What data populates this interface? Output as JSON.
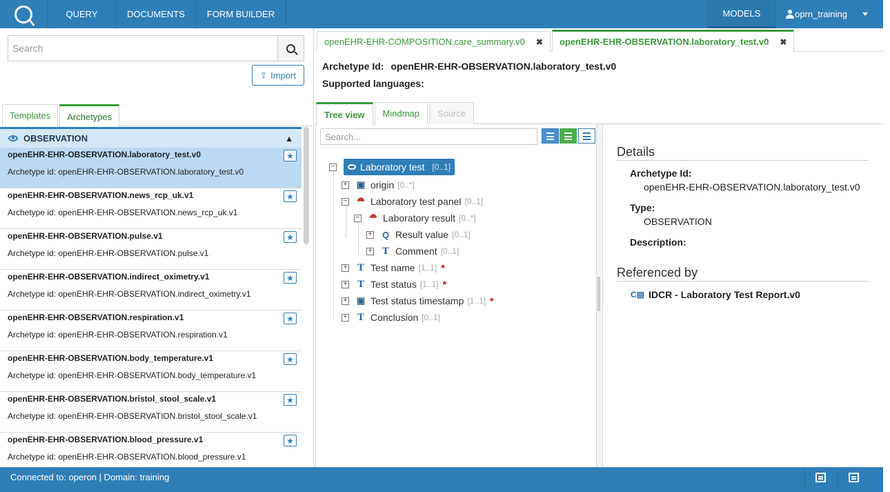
{
  "nav": {
    "logo": "Q",
    "items": [
      "QUERY",
      "DOCUMENTS",
      "FORM BUILDER"
    ],
    "models": "MODELS",
    "user": "oprn_training"
  },
  "left": {
    "search_placeholder": "Search",
    "import_label": "Import",
    "tabs": [
      "Templates",
      "Archetypes"
    ],
    "group": "OBSERVATION",
    "items": [
      {
        "name": "openEHR-EHR-OBSERVATION.laboratory_test.v0",
        "id": "Archetype id: openEHR-EHR-OBSERVATION.laboratory_test.v0"
      },
      {
        "name": "openEHR-EHR-OBSERVATION.news_rcp_uk.v1",
        "id": "Archetype id: openEHR-EHR-OBSERVATION.news_rcp_uk.v1"
      },
      {
        "name": "openEHR-EHR-OBSERVATION.pulse.v1",
        "id": "Archetype id: openEHR-EHR-OBSERVATION.pulse.v1"
      },
      {
        "name": "openEHR-EHR-OBSERVATION.indirect_oximetry.v1",
        "id": "Archetype id: openEHR-EHR-OBSERVATION.indirect_oximetry.v1"
      },
      {
        "name": "openEHR-EHR-OBSERVATION.respiration.v1",
        "id": "Archetype id: openEHR-EHR-OBSERVATION.respiration.v1"
      },
      {
        "name": "openEHR-EHR-OBSERVATION.body_temperature.v1",
        "id": "Archetype id: openEHR-EHR-OBSERVATION.body_temperature.v1"
      },
      {
        "name": "openEHR-EHR-OBSERVATION.bristol_stool_scale.v1",
        "id": "Archetype id: openEHR-EHR-OBSERVATION.bristol_stool_scale.v1"
      },
      {
        "name": "openEHR-EHR-OBSERVATION.blood_pressure.v1",
        "id": "Archetype id: openEHR-EHR-OBSERVATION.blood_pressure.v1"
      }
    ]
  },
  "right": {
    "file_tabs": [
      "openEHR-EHR-COMPOSITION.care_summary.v0",
      "openEHR-EHR-OBSERVATION.laboratory_test.v0"
    ],
    "archetype_id_label": "Archetype Id:",
    "archetype_id_value": "openEHR-EHR-OBSERVATION.laboratory_test.v0",
    "languages_label": "Supported languages:",
    "view_tabs": [
      "Tree view",
      "Mindmap",
      "Source"
    ],
    "tree_search_placeholder": "Search...",
    "tree": [
      {
        "label": "Laboratory test",
        "occ": "[0..1]"
      },
      {
        "label": "origin",
        "occ": "[0..*]"
      },
      {
        "label": "Laboratory test panel",
        "occ": "[0..1]"
      },
      {
        "label": "Laboratory result",
        "occ": "[0..*]"
      },
      {
        "label": "Result value",
        "occ": "[0..1]"
      },
      {
        "label": "Comment",
        "occ": "[0..1]"
      },
      {
        "label": "Test name",
        "occ": "[1..1]",
        "req": "*"
      },
      {
        "label": "Test status",
        "occ": "[1..1]",
        "req": "*"
      },
      {
        "label": "Test status timestamp",
        "occ": "[1..1]",
        "req": "*"
      },
      {
        "label": "Conclusion",
        "occ": "[0..1]"
      }
    ],
    "details": {
      "heading": "Details",
      "archetype_id_label": "Archetype Id:",
      "archetype_id_value": "openEHR-EHR-OBSERVATION.laboratory_test.v0",
      "type_label": "Type:",
      "type_value": "OBSERVATION",
      "description_label": "Description:",
      "referenced_heading": "Referenced by",
      "referenced_item": "IDCR - Laboratory Test Report.v0"
    }
  },
  "status": {
    "text": "Connected to: operon | Domain: training"
  },
  "colors": {
    "primary": "#2e7fb8",
    "green": "#3a9a3a",
    "selected": "#bcd9f3"
  }
}
